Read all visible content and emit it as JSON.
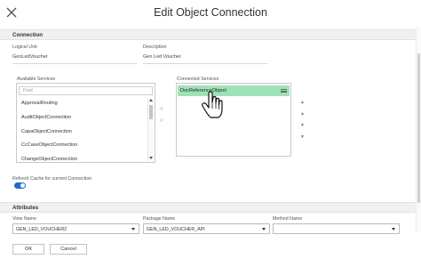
{
  "dialog": {
    "title": "Edit Object Connection",
    "close_icon": "close-icon"
  },
  "connection": {
    "section_label": "Connection",
    "logical_unit_label": "Logical Unit",
    "logical_unit_value": "GenLedVoucher",
    "description_label": "Description",
    "description_value": "Gen Led Voucher",
    "available_label": "Available Services",
    "find_placeholder": "Find",
    "available_items": [
      "ApprovalRouting",
      "AuditObjectConnection",
      "CapaObjectConnection",
      "CcCaseObjectConnection",
      "ChangeObjectConnection"
    ],
    "move_right": "»",
    "move_left": "«",
    "connected_label": "Connected Services",
    "connected_items": [
      "DocReferenceObject"
    ],
    "order_buttons": [
      "▲",
      "▲",
      "▼",
      "▼"
    ],
    "refresh_label": "Refresh Cache for current Connection",
    "refresh_on": true
  },
  "attributes": {
    "section_label": "Attributes",
    "view_name_label": "View Name",
    "view_name_value": "GEN_LED_VOUCHER2",
    "package_name_label": "Package Name",
    "package_name_value": "GEN_LED_VOUCHER_API",
    "method_name_label": "Method Name",
    "method_name_value": ""
  },
  "footer": {
    "ok_label": "OK",
    "cancel_label": "Cancel"
  },
  "colors": {
    "accent": "#1f6fc5",
    "selected_row": "#9ee3b8"
  }
}
